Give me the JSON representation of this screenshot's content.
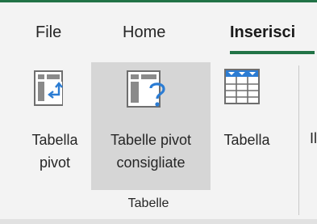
{
  "tabs": [
    {
      "label": "File"
    },
    {
      "label": "Home"
    },
    {
      "label": "Inserisci",
      "active": true
    }
  ],
  "ribbon": {
    "group_name": "Tabelle",
    "commands": {
      "pivot": {
        "line1": "Tabella",
        "line2": "pivot",
        "icon": "pivot-table-icon"
      },
      "recommended": {
        "line1": "Tabelle pivot",
        "line2": "consigliate",
        "icon": "recommended-pivot-icon",
        "state": "hover"
      },
      "table": {
        "line1": "Tabella",
        "icon": "table-icon"
      }
    },
    "next_command_partial": "Il"
  },
  "colors": {
    "accent": "#217346",
    "icon_blue": "#2b7cd3",
    "hover_bg": "#d6d6d6",
    "ribbon_bg": "#f3f3f3"
  }
}
